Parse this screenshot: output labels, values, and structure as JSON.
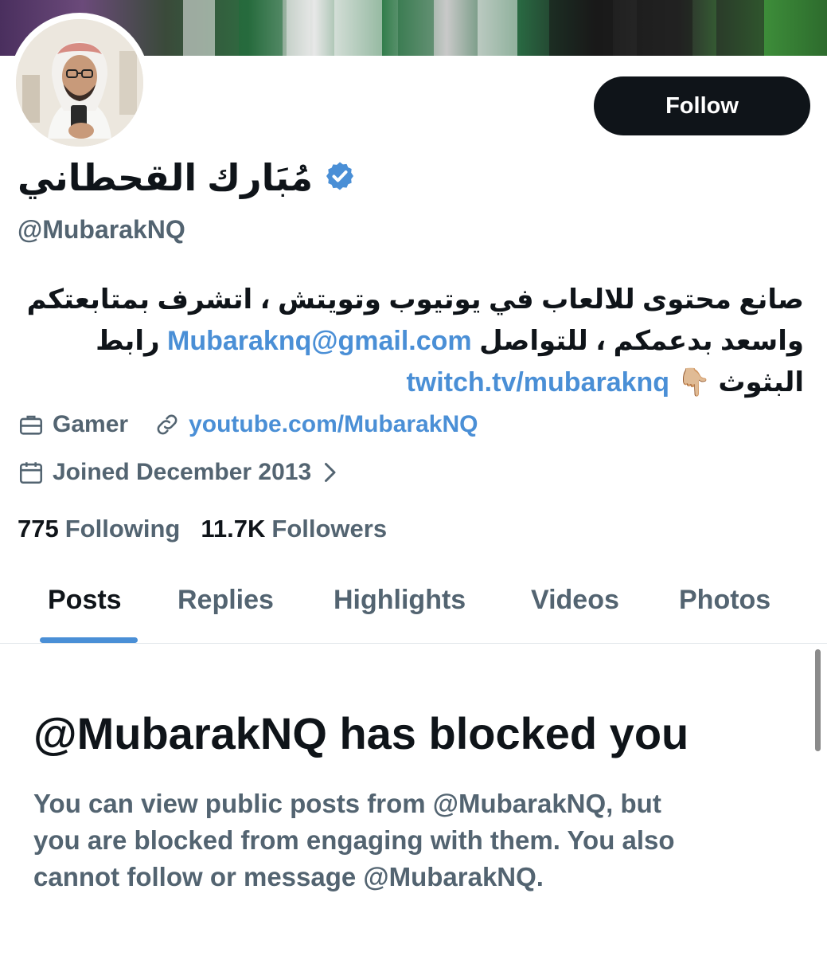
{
  "profile": {
    "display_name": "مُبَارك القحطاني",
    "handle": "@MubarakNQ",
    "verified_icon": "verified-badge-icon",
    "follow_label": "Follow",
    "bio": {
      "line1": "صانع محتوى للالعاب في يوتيوب وتويتش ، اتشرف بمتابعتكم",
      "line2_text": "واسعد بدعمكم ، للتواصل",
      "line2_link": "Mubaraknq@gmail.com",
      "line2_tail": "رابط",
      "line3_text": "البثوث",
      "line3_emoji": "👇🏼",
      "line3_link": "twitch.tv/mubaraknq"
    },
    "category": "Gamer",
    "website": "youtube.com/MubarakNQ",
    "joined": "Joined December 2013",
    "following_count": "775",
    "following_label": "Following",
    "followers_count": "11.7K",
    "followers_label": "Followers"
  },
  "tabs": [
    {
      "label": "Posts",
      "active": true
    },
    {
      "label": "Replies",
      "active": false
    },
    {
      "label": "Highlights",
      "active": false
    },
    {
      "label": "Videos",
      "active": false
    },
    {
      "label": "Photos",
      "active": false
    }
  ],
  "blocked": {
    "title": "@MubarakNQ has blocked you",
    "line1": "You can view public posts from @MubarakNQ, but",
    "line2": "you are blocked from engaging with them. You also",
    "line3": "cannot follow or message @MubarakNQ."
  },
  "colors": {
    "accent": "#4a8fd6",
    "text_primary": "#0f1419",
    "text_secondary": "#536471",
    "verified": "#4a8fd6"
  }
}
